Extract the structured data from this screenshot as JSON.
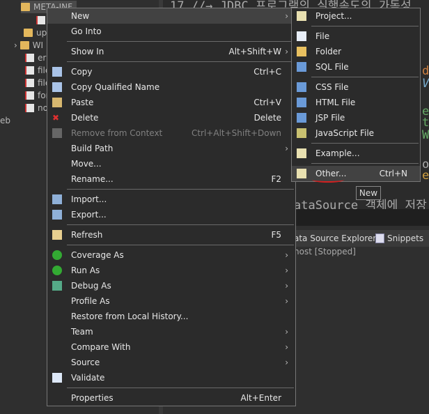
{
  "tree": [
    "META-INF",
    "",
    "up",
    "WI",
    "err",
    "file",
    "file",
    "for",
    "no",
    "eb"
  ],
  "editor": {
    "line1": "17 //→ JDBC 프로그램의 실행속도의 가독성",
    "line2": "ataSource 객체에 저장",
    "frag": [
      "ds",
      "Ve",
      "et",
      "t/",
      "Wr",
      "ou",
      "ew"
    ]
  },
  "panel": {
    "tab1": "ata Source Explorer",
    "tab2": "Snippets",
    "server": "host  [Stopped]"
  },
  "menu": [
    {
      "label": "New",
      "arrow": true,
      "hl": true
    },
    {
      "label": "Go Into"
    },
    {
      "sep": true
    },
    {
      "label": "Show In",
      "shortcut": "Alt+Shift+W",
      "arrow": true
    },
    {
      "sep": true
    },
    {
      "label": "Copy",
      "shortcut": "Ctrl+C",
      "icon": "copy-icon"
    },
    {
      "label": "Copy Qualified Name",
      "icon": "copy-qualified-icon"
    },
    {
      "label": "Paste",
      "shortcut": "Ctrl+V",
      "icon": "paste-icon"
    },
    {
      "label": "Delete",
      "shortcut": "Delete",
      "icon": "delete-icon"
    },
    {
      "label": "Remove from Context",
      "shortcut": "Ctrl+Alt+Shift+Down",
      "icon": "remove-context-icon",
      "disabled": true
    },
    {
      "label": "Build Path",
      "arrow": true
    },
    {
      "label": "Move..."
    },
    {
      "label": "Rename...",
      "shortcut": "F2"
    },
    {
      "sep": true
    },
    {
      "label": "Import...",
      "icon": "import-icon"
    },
    {
      "label": "Export...",
      "icon": "export-icon"
    },
    {
      "sep": true
    },
    {
      "label": "Refresh",
      "shortcut": "F5",
      "icon": "refresh-icon"
    },
    {
      "sep": true
    },
    {
      "label": "Coverage As",
      "arrow": true,
      "icon": "coverage-icon"
    },
    {
      "label": "Run As",
      "arrow": true,
      "icon": "run-icon"
    },
    {
      "label": "Debug As",
      "arrow": true,
      "icon": "debug-icon"
    },
    {
      "label": "Profile As",
      "arrow": true
    },
    {
      "label": "Restore from Local History..."
    },
    {
      "label": "Team",
      "arrow": true
    },
    {
      "label": "Compare With",
      "arrow": true
    },
    {
      "label": "Source",
      "arrow": true
    },
    {
      "label": "Validate",
      "icon": "validate-checkbox-icon"
    },
    {
      "sep": true
    },
    {
      "label": "Properties",
      "shortcut": "Alt+Enter"
    }
  ],
  "submenu": [
    {
      "label": "Project...",
      "icon": "new-project-icon"
    },
    {
      "sep": true
    },
    {
      "label": "File",
      "icon": "new-file-icon"
    },
    {
      "label": "Folder",
      "icon": "new-folder-icon"
    },
    {
      "label": "SQL File",
      "icon": "sql-file-icon"
    },
    {
      "sep": true
    },
    {
      "label": "CSS File",
      "icon": "css-file-icon"
    },
    {
      "label": "HTML File",
      "icon": "html-file-icon"
    },
    {
      "label": "JSP File",
      "icon": "jsp-file-icon"
    },
    {
      "label": "JavaScript File",
      "icon": "javascript-file-icon"
    },
    {
      "sep": true
    },
    {
      "label": "Example...",
      "icon": "new-example-icon"
    },
    {
      "sep": true
    },
    {
      "label": "Other...",
      "shortcut": "Ctrl+N",
      "icon": "new-other-icon",
      "hl": true
    }
  ],
  "tooltip": "New",
  "colors": {
    "menu_bg": "#2b2b2b",
    "highlight": "#424242",
    "annotation": "#d42020"
  }
}
